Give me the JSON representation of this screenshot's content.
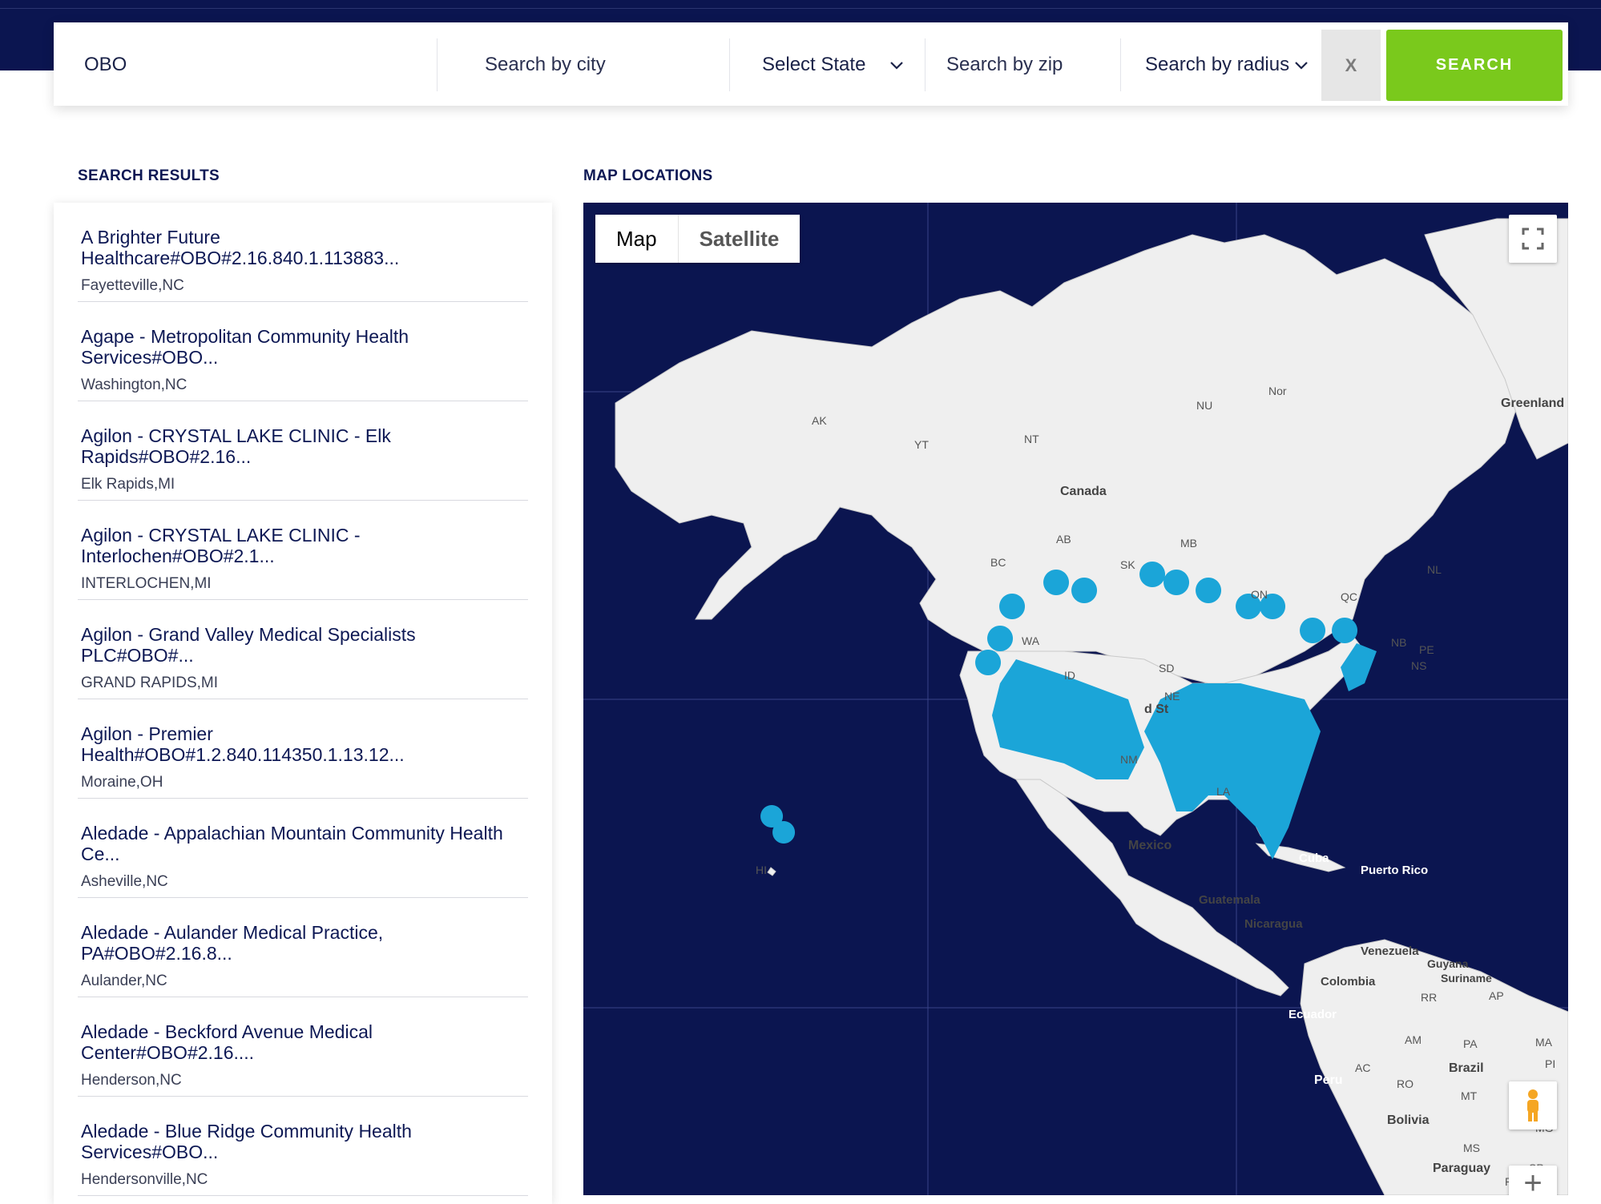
{
  "search": {
    "name_value": "OBO",
    "city_placeholder": "Search by city",
    "state_label": "Select State",
    "zip_placeholder": "Search by zip",
    "radius_label": "Search by radius",
    "clear_label": "X",
    "search_label": "SEARCH"
  },
  "sections": {
    "results_title": "SEARCH RESULTS",
    "map_title": "MAP LOCATIONS"
  },
  "results": [
    {
      "name": "A Brighter Future Healthcare#OBO#2.16.840.1.113883...",
      "location": "Fayetteville,NC"
    },
    {
      "name": "Agape - Metropolitan Community Health Services#OBO...",
      "location": "Washington,NC"
    },
    {
      "name": "Agilon - CRYSTAL LAKE CLINIC - Elk Rapids#OBO#2.16...",
      "location": "Elk Rapids,MI"
    },
    {
      "name": "Agilon - CRYSTAL LAKE CLINIC - Interlochen#OBO#2.1...",
      "location": "INTERLOCHEN,MI"
    },
    {
      "name": "Agilon - Grand Valley Medical Specialists PLC#OBO#...",
      "location": "GRAND RAPIDS,MI"
    },
    {
      "name": "Agilon - Premier Health#OBO#1.2.840.114350.1.13.12...",
      "location": "Moraine,OH"
    },
    {
      "name": "Aledade - Appalachian Mountain Community Health Ce...",
      "location": "Asheville,NC"
    },
    {
      "name": "Aledade - Aulander Medical Practice, PA#OBO#2.16.8...",
      "location": "Aulander,NC"
    },
    {
      "name": "Aledade - Beckford Avenue Medical Center#OBO#2.16....",
      "location": "Henderson,NC"
    },
    {
      "name": "Aledade - Blue Ridge Community Health Services#OBO...",
      "location": "Hendersonville,NC"
    }
  ],
  "map": {
    "tabs": [
      "Map",
      "Satellite"
    ],
    "zoom_in_label": "+",
    "colors": {
      "ocean": "#0b1550",
      "land": "#efefef",
      "pin": "#1ba5d8",
      "search_button": "#7ac91c"
    },
    "labels": {
      "greenland": "Greenland",
      "canada": "Canada",
      "mexico": "Mexico",
      "cuba": "Cuba",
      "puerto_rico": "Puerto Rico",
      "guatemala": "Guatemala",
      "nicaragua": "Nicaragua",
      "venezuela": "Venezuela",
      "guyana": "Guyana",
      "suriname": "Suriname",
      "colombia": "Colombia",
      "ecuador": "Ecuador",
      "peru": "Peru",
      "brazil": "Brazil",
      "bolivia": "Bolivia",
      "paraguay": "Paraguay",
      "united_states_partial": "d St",
      "ak": "AK",
      "yt": "YT",
      "nt": "NT",
      "nu": "NU",
      "bc": "BC",
      "ab": "AB",
      "sk": "SK",
      "mb": "MB",
      "on": "ON",
      "qc": "QC",
      "nl": "NL",
      "nb": "NB",
      "pe": "PE",
      "ns": "NS",
      "wa": "WA",
      "id": "ID",
      "ne": "NE",
      "sd": "SD",
      "nm": "NM",
      "la": "LA",
      "hi": "HI",
      "nor": "Nor",
      "rr": "RR",
      "ap": "AP",
      "am": "AM",
      "pa": "PA",
      "ma": "MA",
      "pi": "PI",
      "ac": "AC",
      "ro": "RO",
      "mt": "MT",
      "ms": "MS",
      "mg": "MG",
      "sp": "SP",
      "pr": "PR"
    }
  }
}
